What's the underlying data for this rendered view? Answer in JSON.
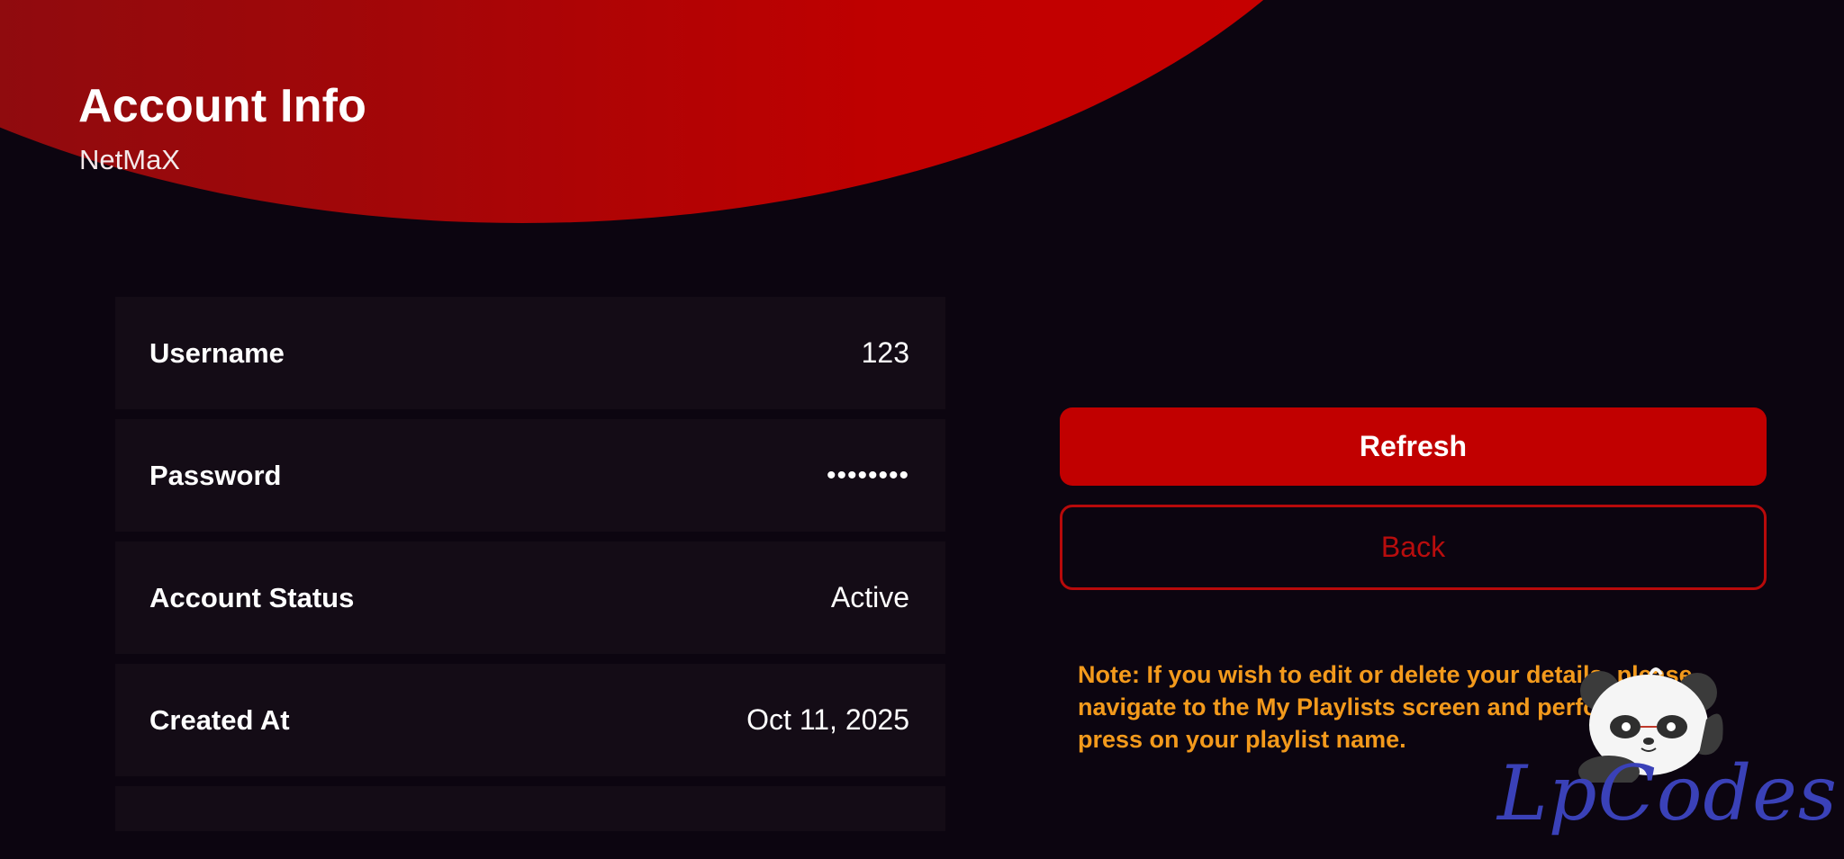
{
  "header": {
    "title": "Account Info",
    "subtitle": "NetMaX"
  },
  "account": {
    "rows": [
      {
        "label": "Username",
        "value": "123"
      },
      {
        "label": "Password",
        "value": "••••••••"
      },
      {
        "label": "Account Status",
        "value": "Active"
      },
      {
        "label": "Created At",
        "value": "Oct 11, 2025"
      }
    ]
  },
  "actions": {
    "refresh_label": "Refresh",
    "back_label": "Back"
  },
  "note": {
    "text": "Note: If you wish to edit or delete your details, please navigate to the My Playlists screen and perform a long press on your playlist name."
  },
  "watermark": {
    "text": "LpCodes",
    "icon": "panda-icon"
  },
  "colors": {
    "background": "#0c0510",
    "accent": "#c10000",
    "row_background": "#140c16",
    "note": "#f39a1c",
    "watermark": "#3a41b8"
  }
}
